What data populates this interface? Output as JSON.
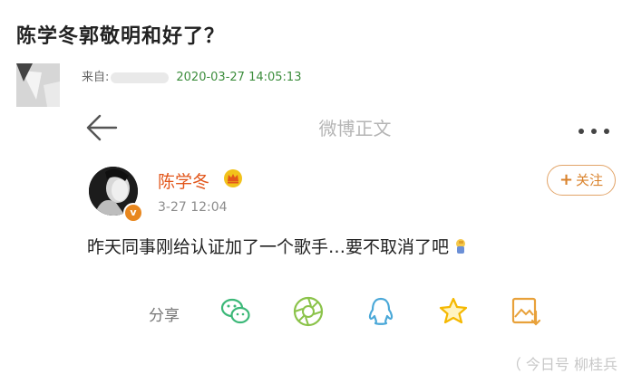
{
  "article": {
    "title": "陈学冬郭敬明和好了？",
    "meta": {
      "from_label": "来自:",
      "timestamp": "2020-03-27 14:05:13"
    }
  },
  "weibo": {
    "topbar": {
      "title": "微博正文"
    },
    "post": {
      "author": "陈学冬",
      "time": "3-27 12:04",
      "text": "昨天同事刚给认证加了一个歌手…要不取消了吧",
      "verified_badge": "v"
    },
    "follow": {
      "plus": "+",
      "label": "关注"
    },
    "share": {
      "label": "分享",
      "icons": [
        "wechat-icon",
        "moments-icon",
        "qq-icon",
        "favorite-icon",
        "save-image-icon"
      ]
    }
  },
  "watermark": "（ 今日号 柳桂兵",
  "colors": {
    "accent": "#e2561b",
    "follow_border": "#e2a468",
    "share_green": "#3cb878",
    "share_blue": "#4aa8d8",
    "star_yellow": "#f5b800",
    "timestamp_green": "#3c8d3c"
  }
}
